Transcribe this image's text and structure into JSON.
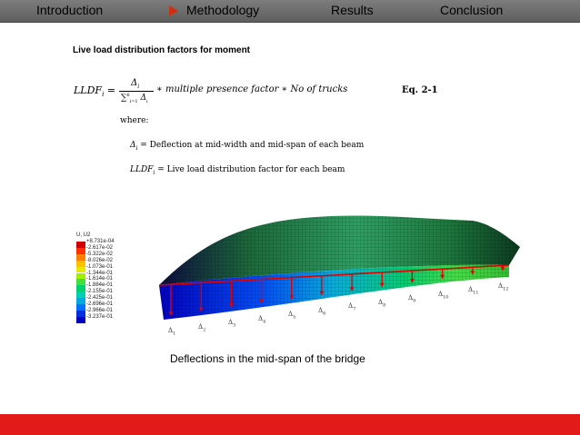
{
  "nav": {
    "items": [
      {
        "label": "Introduction"
      },
      {
        "label": "Methodology"
      },
      {
        "label": "Results"
      },
      {
        "label": "Conclusion"
      }
    ],
    "accent": "#d03010",
    "bar_color": "#6e6e6e"
  },
  "slide": {
    "title": "Live load distribution factors for moment",
    "equation": {
      "lhs": "LLDF",
      "lhs_sub": "i",
      "equals": "=",
      "num": "Δ",
      "num_sub": "i",
      "den": "∑",
      "den_sup": "6",
      "den_sub": "i=1",
      "den_delta": "Δ",
      "den_delta_sub": "i",
      "rest": "∗ multiple presence factor ∗ No of trucks",
      "label": "Eq. 2-1"
    },
    "where_label": "where:",
    "def1": {
      "sym": "Δ",
      "sub": "i",
      "text": " = Deflection at mid-width and mid-span of each beam"
    },
    "def2": {
      "sym": "LLDF",
      "sub": "i",
      "text": " = Live load distribution factor for each beam"
    },
    "caption": "Deflections in the mid-span of the bridge"
  },
  "legend": {
    "title": "U, U2",
    "values": [
      "+8.731e-04",
      "-2.617e-02",
      "-5.322e-02",
      "-8.026e-02",
      "-1.073e-01",
      "-1.344e-01",
      "-1.614e-01",
      "-1.884e-01",
      "-2.155e-01",
      "-2.425e-01",
      "-2.696e-01",
      "-2.966e-01",
      "-3.237e-01"
    ],
    "colors": [
      "#d00000",
      "#ff3000",
      "#ff8000",
      "#ffc000",
      "#e8e800",
      "#a0f000",
      "#40e040",
      "#00d070",
      "#00d0b0",
      "#00a8e0",
      "#0070ff",
      "#0030e0",
      "#0000c0"
    ]
  },
  "deltas": [
    {
      "label": "Δ",
      "sub": "1"
    },
    {
      "label": "Δ",
      "sub": "2"
    },
    {
      "label": "Δ",
      "sub": "3"
    },
    {
      "label": "Δ",
      "sub": "4"
    },
    {
      "label": "Δ",
      "sub": "5"
    },
    {
      "label": "Δ",
      "sub": "6"
    },
    {
      "label": "Δ",
      "sub": "7"
    },
    {
      "label": "Δ",
      "sub": "8"
    },
    {
      "label": "Δ",
      "sub": "9"
    },
    {
      "label": "Δ",
      "sub": "10"
    },
    {
      "label": "Δ",
      "sub": "11"
    },
    {
      "label": "Δ",
      "sub": "12"
    }
  ],
  "bottom_bar_color": "#e21a1a"
}
